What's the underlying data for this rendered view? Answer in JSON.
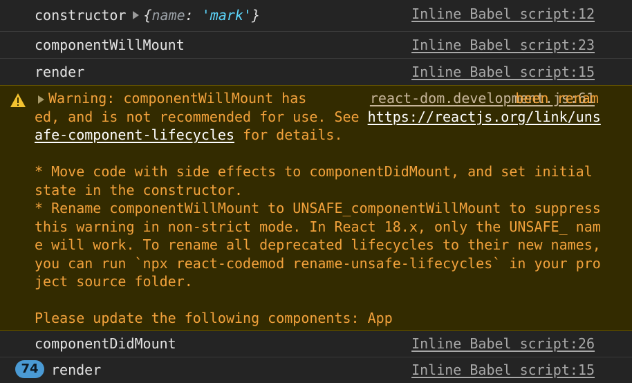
{
  "rows": [
    {
      "message": "constructor",
      "object": {
        "open": "{",
        "key": "name",
        "colon": ": ",
        "value": "'mark'",
        "close": "}"
      },
      "source": "Inline Babel script:12"
    },
    {
      "message": "componentWillMount",
      "source": "Inline Babel script:23"
    },
    {
      "message": "render",
      "source": "Inline Babel script:15"
    }
  ],
  "warning": {
    "icon": "warning-triangle-icon",
    "source": "react-dom.development.js:61",
    "line1": "Warning: componentWillMount has ",
    "line2": "been renamed, and is not recommended for use. See ",
    "link": "https://reactjs.org/link/unsafe-component-lifecycles",
    "line2_end": " for details.",
    "bullet1": "* Move code with side effects to componentDidMount, and set initial state in the constructor.",
    "bullet2": "* Rename componentWillMount to UNSAFE_componentWillMount to suppress this warning in non-strict mode. In React 18.x, only the UNSAFE_ name will work. To rename all deprecated lifecycles to their new names, you can run `npx react-codemod rename-unsafe-lifecycles` in your project source folder.",
    "footer": "Please update the following components: App"
  },
  "after_rows": [
    {
      "message": "componentDidMount",
      "source": "Inline Babel script:26"
    },
    {
      "message": "render",
      "badge": "74",
      "source": "Inline Babel script:15"
    }
  ],
  "colors": {
    "background": "#242424",
    "warning_background": "#332b00",
    "warning_text": "#f2a23c",
    "badge": "#4a9ad4"
  }
}
